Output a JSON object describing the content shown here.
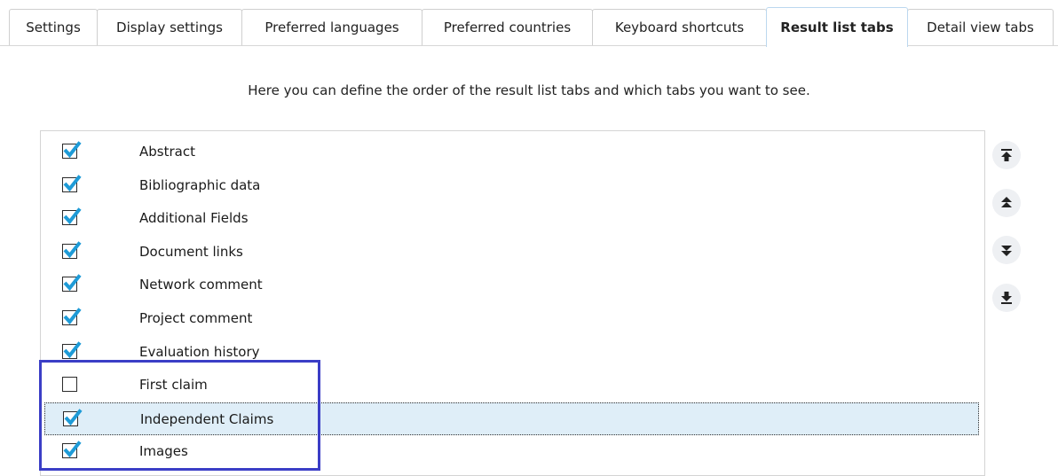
{
  "tabs": [
    {
      "label": "Settings",
      "active": false
    },
    {
      "label": "Display settings",
      "active": false
    },
    {
      "label": "Preferred languages",
      "active": false
    },
    {
      "label": "Preferred countries",
      "active": false
    },
    {
      "label": "Keyboard shortcuts",
      "active": false
    },
    {
      "label": "Result list tabs",
      "active": true
    },
    {
      "label": "Detail view tabs",
      "active": false
    }
  ],
  "intro_text": "Here you can define the order of the result list tabs and which tabs you want to see.",
  "list_items": [
    {
      "label": "Abstract",
      "checked": true,
      "selected": false
    },
    {
      "label": "Bibliographic data",
      "checked": true,
      "selected": false
    },
    {
      "label": "Additional Fields",
      "checked": true,
      "selected": false
    },
    {
      "label": "Document links",
      "checked": true,
      "selected": false
    },
    {
      "label": "Network comment",
      "checked": true,
      "selected": false
    },
    {
      "label": "Project comment",
      "checked": true,
      "selected": false
    },
    {
      "label": "Evaluation history",
      "checked": true,
      "selected": false
    },
    {
      "label": "First claim",
      "checked": false,
      "selected": false
    },
    {
      "label": "Independent Claims",
      "checked": true,
      "selected": true
    },
    {
      "label": "Images",
      "checked": true,
      "selected": false
    }
  ],
  "move_buttons": [
    {
      "icon": "move-to-top-icon"
    },
    {
      "icon": "move-up-icon"
    },
    {
      "icon": "move-down-icon"
    },
    {
      "icon": "move-to-bottom-icon"
    }
  ],
  "colors": {
    "check_mark": "#1e9bd7",
    "selected_row": "#dfeef8",
    "highlight_border": "#3b3ec6",
    "move_button_bg": "#eef0f3"
  }
}
